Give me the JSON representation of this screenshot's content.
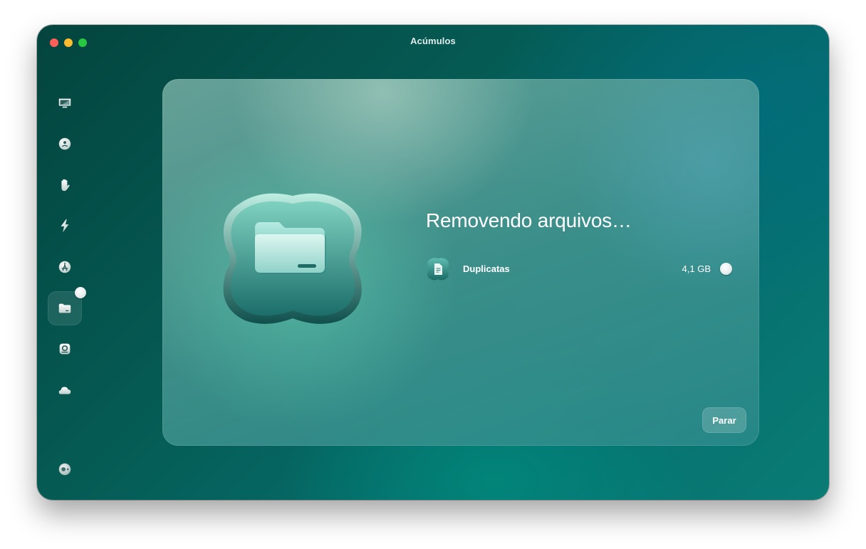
{
  "window": {
    "title": "Acúmulos"
  },
  "sidebar": {
    "items": [
      {
        "icon": "monitor-icon"
      },
      {
        "icon": "protection-icon"
      },
      {
        "icon": "privacy-hand-icon"
      },
      {
        "icon": "speed-bolt-icon"
      },
      {
        "icon": "applications-icon"
      },
      {
        "icon": "clutter-folder-icon",
        "active": true
      },
      {
        "icon": "space-lens-icon"
      },
      {
        "icon": "cloud-icon"
      }
    ],
    "footer_icon": "assistant-icon"
  },
  "main": {
    "heading": "Removendo arquivos…",
    "hero_icon": "folder-icon",
    "items": [
      {
        "icon": "duplicates-file-icon",
        "label": "Duplicatas",
        "size": "4,1 GB",
        "status_icon": "progress-spinner-icon"
      }
    ],
    "stop_button": "Parar"
  }
}
